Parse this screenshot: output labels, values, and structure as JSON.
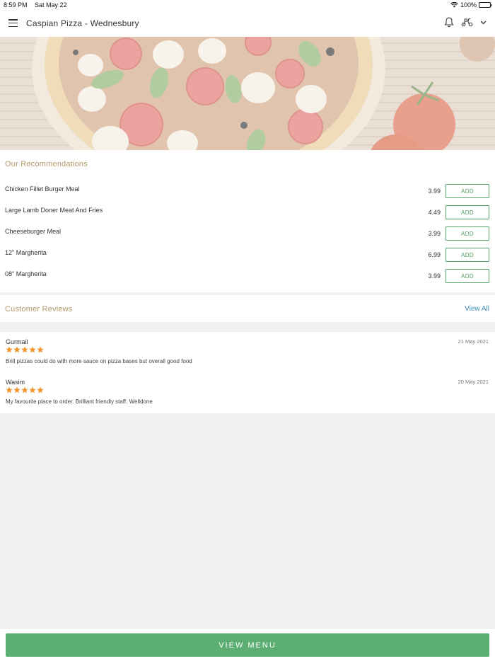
{
  "status_bar": {
    "time": "8:59 PM",
    "date": "Sat May 22",
    "battery": "100%"
  },
  "header": {
    "title": "Caspian Pizza - Wednesbury",
    "icons": [
      "menu-icon",
      "bell-icon",
      "scooter-icon",
      "chevron-down-icon"
    ]
  },
  "recommendations": {
    "title": "Our Recommendations",
    "items": [
      {
        "name": "Chicken Fillet Burger Meal",
        "price": "3.99",
        "button": "ADD"
      },
      {
        "name": "Large Lamb Doner Meat And Fries",
        "price": "4.49",
        "button": "ADD"
      },
      {
        "name": "Cheeseburger Meal",
        "price": "3.99",
        "button": "ADD"
      },
      {
        "name": "12\" Margherita",
        "price": "6.99",
        "button": "ADD"
      },
      {
        "name": "08\" Margherita",
        "price": "3.99",
        "button": "ADD"
      }
    ]
  },
  "reviews": {
    "title": "Customer Reviews",
    "view_all": "View All",
    "items": [
      {
        "name": "Gurmail",
        "date": "21 May 2021",
        "rating": 5,
        "text": "Brill pizzas could do with more sauce on pizza bases but overall good food"
      },
      {
        "name": "Wasim",
        "date": "20 May 2021",
        "rating": 5,
        "text": "My favourite place to order. Brilliant friendly staff. Welldone"
      }
    ]
  },
  "footer": {
    "button": "VIEW MENU"
  },
  "colors": {
    "accent_green": "#5cae72",
    "section_title": "#b39b6b",
    "link_blue": "#3a8bb7",
    "star": "#f0952b"
  }
}
